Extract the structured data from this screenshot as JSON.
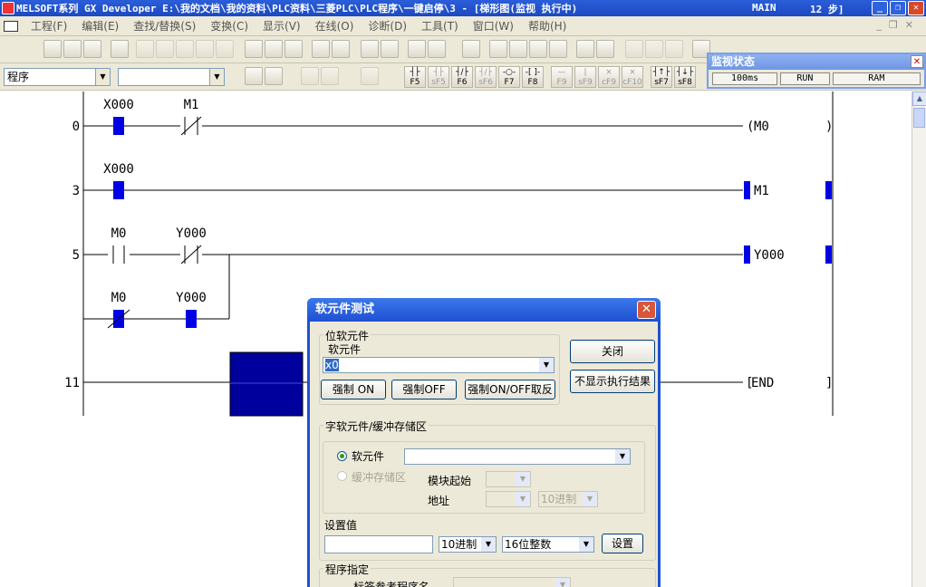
{
  "window": {
    "title": "MELSOFT系列 GX Developer E:\\我的文档\\我的资料\\PLC资料\\三菱PLC\\PLC程序\\一键启停\\3 - [梯形图(监视 执行中)",
    "mode": "MAIN",
    "steps": "12 步]"
  },
  "menu": [
    "工程(F)",
    "编辑(E)",
    "查找/替换(S)",
    "变换(C)",
    "显示(V)",
    "在线(O)",
    "诊断(D)",
    "工具(T)",
    "窗口(W)",
    "帮助(H)"
  ],
  "toolbar": {
    "program_combo": "程序",
    "second_combo": "",
    "fkeys": [
      {
        "sym": "┤├",
        "label": "F5",
        "disabled": false
      },
      {
        "sym": "┤├",
        "label": "sF5",
        "disabled": true
      },
      {
        "sym": "┤/├",
        "label": "F6",
        "disabled": false
      },
      {
        "sym": "┤/├",
        "label": "sF6",
        "disabled": true
      },
      {
        "sym": "-○-",
        "label": "F7",
        "disabled": false
      },
      {
        "sym": "-[ ]-",
        "label": "F8",
        "disabled": false
      },
      {
        "sym": "—",
        "label": "F9",
        "disabled": true
      },
      {
        "sym": "|",
        "label": "sF9",
        "disabled": true
      },
      {
        "sym": "×",
        "label": "cF9",
        "disabled": true
      },
      {
        "sym": "×",
        "label": "cF10",
        "disabled": true
      },
      {
        "sym": "┤↑├",
        "label": "sF7",
        "disabled": false
      },
      {
        "sym": "┤↓├",
        "label": "sF8",
        "disabled": false
      }
    ]
  },
  "monitor_status": {
    "title": "监视状态",
    "scan_time": "100ms",
    "cpu_state": "RUN",
    "memory": "RAM"
  },
  "ladder": {
    "rungs": [
      {
        "step": "0",
        "contacts": [
          {
            "label": "X000",
            "type": "NO",
            "on": true
          },
          {
            "label": "M1",
            "type": "NC",
            "on": false
          }
        ],
        "coil": "M0",
        "coil_on": false
      },
      {
        "step": "3",
        "contacts": [
          {
            "label": "X000",
            "type": "NO",
            "on": true
          }
        ],
        "coil": "M1",
        "coil_on": true
      },
      {
        "step": "5",
        "contacts": [
          {
            "label": "M0",
            "type": "NO",
            "on": false
          },
          {
            "label": "Y000",
            "type": "NC",
            "on": false
          }
        ],
        "branch": [
          {
            "label": "M0",
            "type": "NC",
            "on": true
          },
          {
            "label": "Y000",
            "type": "NO",
            "on": true
          }
        ],
        "coil": "Y000",
        "coil_on": true
      },
      {
        "step": "11",
        "coil": "END"
      }
    ]
  },
  "dialog": {
    "title": "软元件测试",
    "bit_group": "位软元件",
    "device_label": "软元件",
    "device_value": "x0",
    "force_on": "强制 ON",
    "force_off": "强制OFF",
    "force_toggle": "强制ON/OFF取反",
    "close": "关闭",
    "hide_result": "不显示执行结果",
    "word_group": "字软元件/缓冲存储区",
    "radio_device": "软元件",
    "radio_buffer": "缓冲存储区",
    "module_start": "模块起始",
    "address": "地址",
    "address_radix": "10进制",
    "set_value": "设置值",
    "radix": "10进制",
    "data_type": "16位整数",
    "set_button": "设置",
    "program_group": "程序指定",
    "label_ref": "标签参考程序名"
  }
}
